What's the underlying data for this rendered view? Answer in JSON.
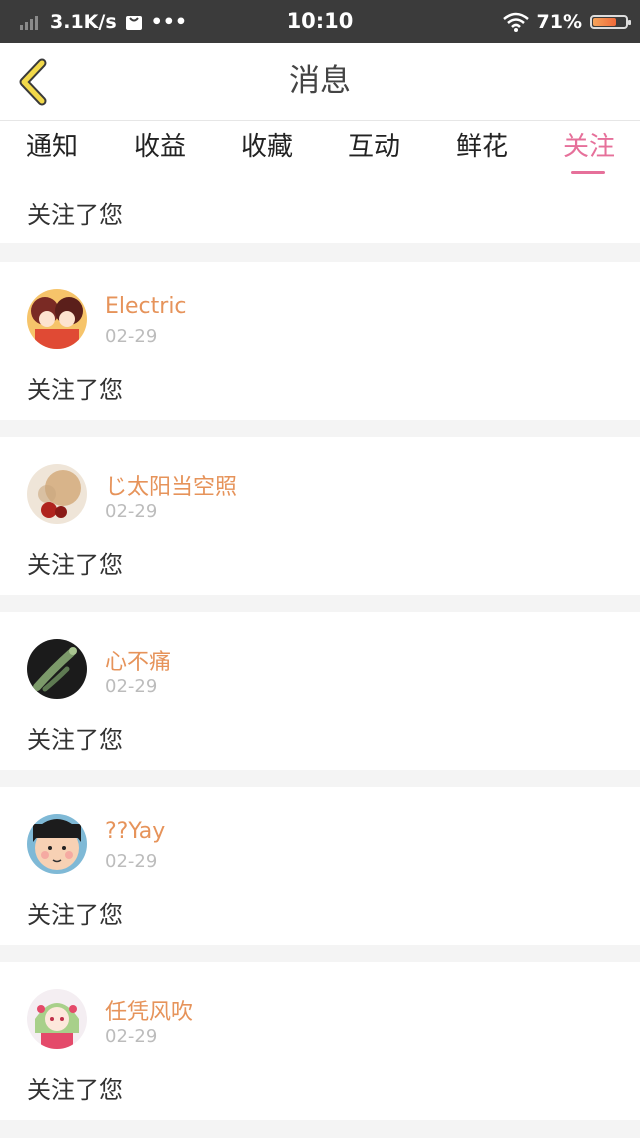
{
  "status_bar": {
    "network_speed": "3.1K/s",
    "more": "•••",
    "time": "10:10",
    "battery_percent": "71%",
    "battery_level": 0.71
  },
  "header": {
    "title": "消息"
  },
  "tabs": [
    {
      "label": "通知"
    },
    {
      "label": "收益"
    },
    {
      "label": "收藏"
    },
    {
      "label": "互动"
    },
    {
      "label": "鲜花"
    },
    {
      "label": "关注",
      "active": true
    }
  ],
  "first_item": {
    "action": "关注了您"
  },
  "items": [
    {
      "name": "Electric",
      "date": "02-29",
      "action": "关注了您"
    },
    {
      "name": "じ太阳当空照",
      "date": "02-29",
      "action": "关注了您"
    },
    {
      "name": "心不痛",
      "date": "02-29",
      "action": "关注了您"
    },
    {
      "name": "??Yay",
      "date": "02-29",
      "action": "关注了您"
    },
    {
      "name": "任凭风吹",
      "date": "02-29",
      "action": "关注了您"
    }
  ],
  "colors": {
    "accent_pink": "#e6709a",
    "username_orange": "#e6935a",
    "date_gray": "#bcbcbc",
    "back_icon_yellow": "#f2d94a"
  }
}
